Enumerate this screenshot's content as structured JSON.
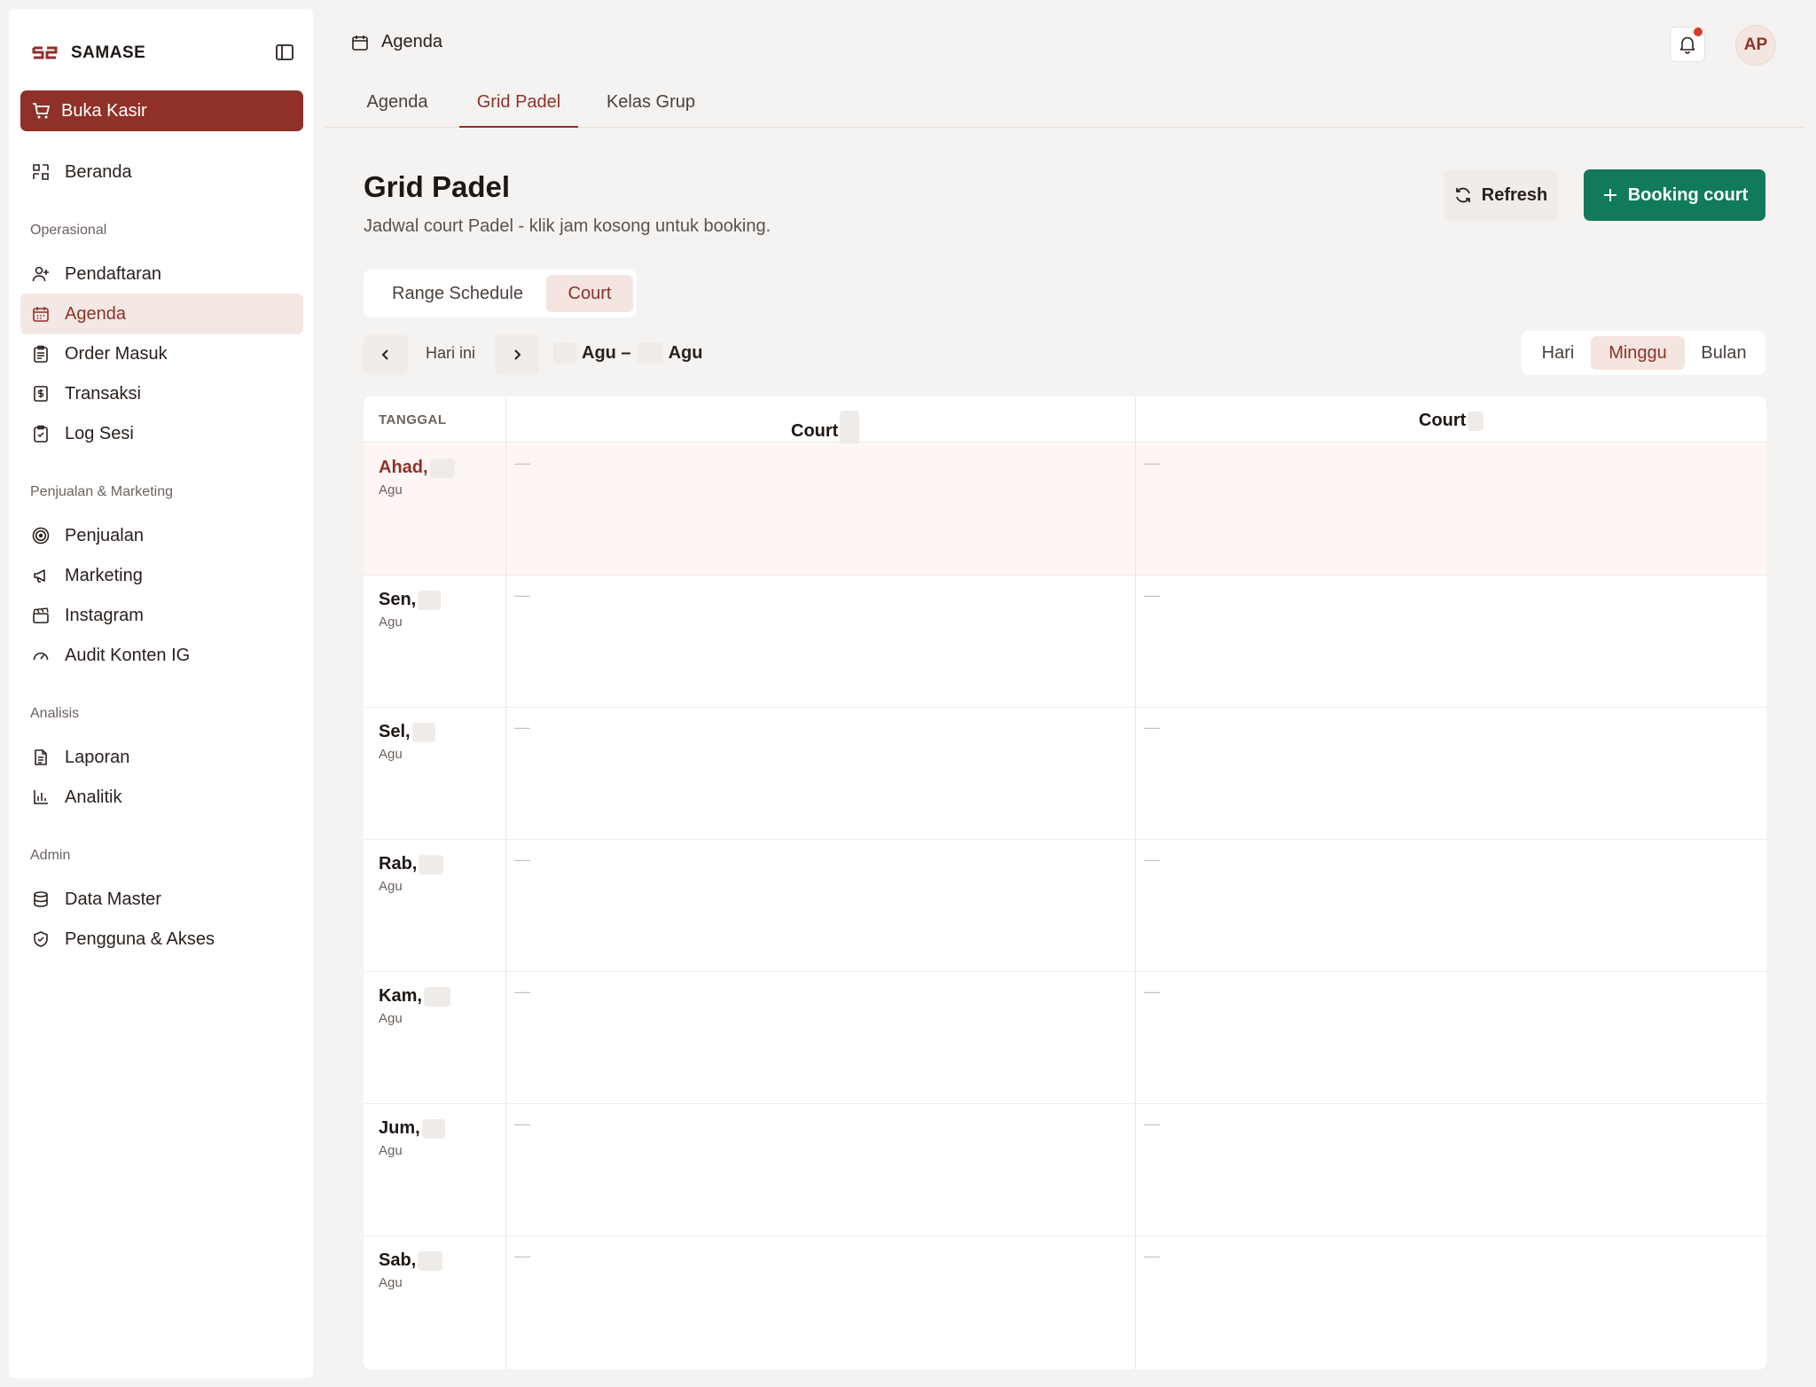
{
  "brand": {
    "name": "SAMASE"
  },
  "sidebar": {
    "kasir_label": "Buka Kasir",
    "home_label": "Beranda",
    "sections": [
      {
        "title": "Operasional",
        "items": [
          {
            "label": "Pendaftaran",
            "icon": "user-plus-icon"
          },
          {
            "label": "Agenda",
            "icon": "calendar-icon",
            "active": true
          },
          {
            "label": "Order Masuk",
            "icon": "clipboard-list-icon"
          },
          {
            "label": "Transaksi",
            "icon": "receipt-dollar-icon"
          },
          {
            "label": "Log Sesi",
            "icon": "clipboard-check-icon"
          }
        ]
      },
      {
        "title": "Penjualan & Marketing",
        "items": [
          {
            "label": "Penjualan",
            "icon": "target-icon"
          },
          {
            "label": "Marketing",
            "icon": "megaphone-icon"
          },
          {
            "label": "Instagram",
            "icon": "clapperboard-icon"
          },
          {
            "label": "Audit Konten IG",
            "icon": "gauge-icon"
          }
        ]
      },
      {
        "title": "Analisis",
        "items": [
          {
            "label": "Laporan",
            "icon": "file-text-icon"
          },
          {
            "label": "Analitik",
            "icon": "bar-chart-icon"
          }
        ]
      },
      {
        "title": "Admin",
        "items": [
          {
            "label": "Data Master",
            "icon": "database-icon"
          },
          {
            "label": "Pengguna & Akses",
            "icon": "shield-check-icon"
          }
        ]
      }
    ]
  },
  "topbar": {
    "title": "Agenda",
    "avatar_initials": "AP"
  },
  "tabs": [
    {
      "label": "Agenda",
      "active": false
    },
    {
      "label": "Grid Padel",
      "active": true
    },
    {
      "label": "Kelas Grup",
      "active": false
    }
  ],
  "header": {
    "title": "Grid Padel",
    "subtitle": "Jadwal court Padel - klik jam kosong untuk booking.",
    "refresh_label": "Refresh",
    "booking_label": "Booking court"
  },
  "mode_toggle": [
    {
      "label": "Range Schedule",
      "active": false
    },
    {
      "label": "Court",
      "active": true
    }
  ],
  "date_nav": {
    "today_label": "Hari ini",
    "range_start_month": "Agu –",
    "range_end_month": "Agu"
  },
  "view_toggle": [
    {
      "label": "Hari",
      "active": false
    },
    {
      "label": "Minggu",
      "active": true
    },
    {
      "label": "Bulan",
      "active": false
    }
  ],
  "grid": {
    "date_header": "TANGGAL",
    "courts": [
      "Court",
      "Court"
    ],
    "empty_marker": "—",
    "rows": [
      {
        "day": "Ahad,",
        "month": "Agu",
        "today": true
      },
      {
        "day": "Sen,",
        "month": "Agu"
      },
      {
        "day": "Sel,",
        "month": "Agu"
      },
      {
        "day": "Rab,",
        "month": "Agu"
      },
      {
        "day": "Kam,",
        "month": "Agu"
      },
      {
        "day": "Jum,",
        "month": "Agu"
      },
      {
        "day": "Sab,",
        "month": "Agu"
      }
    ]
  }
}
